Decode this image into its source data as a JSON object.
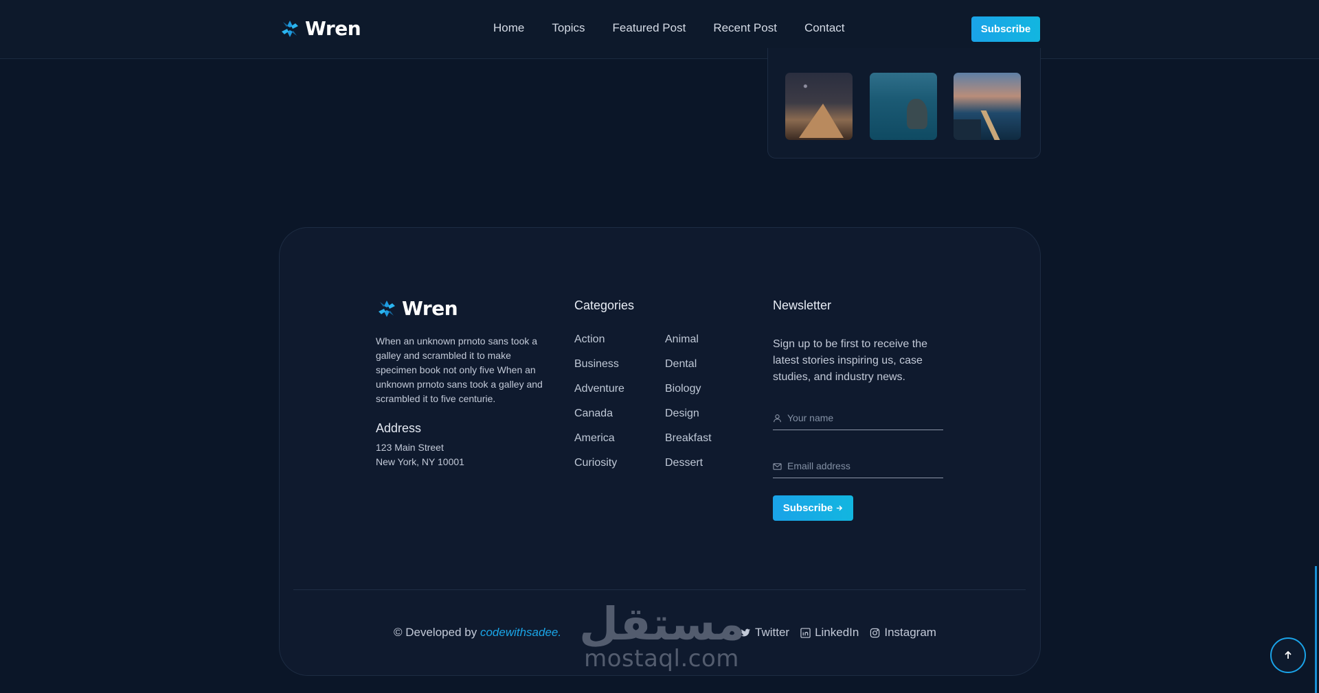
{
  "header": {
    "brand": "Wren",
    "nav": [
      "Home",
      "Topics",
      "Featured Post",
      "Recent Post",
      "Contact"
    ],
    "subscribe_label": "Subscribe"
  },
  "footer": {
    "brand": "Wren",
    "description": "When an unknown prnoto sans took a galley and scrambled it to make specimen book not only five When an unknown prnoto sans took a galley and scrambled it to five centurie.",
    "address_title": "Address",
    "address_line1": "123 Main Street",
    "address_line2": "New York, NY 10001",
    "categories_title": "Categories",
    "categories_left": [
      "Action",
      "Business",
      "Adventure",
      "Canada",
      "America",
      "Curiosity"
    ],
    "categories_right": [
      "Animal",
      "Dental",
      "Biology",
      "Design",
      "Breakfast",
      "Dessert"
    ],
    "newsletter_title": "Newsletter",
    "newsletter_text": "Sign up to be first to receive the latest stories inspiring us, case studies, and industry news.",
    "name_placeholder": "Your name",
    "email_placeholder": "Emaill address",
    "subscribe_label": "Subscribe",
    "copyright_prefix": "© Developed by",
    "copyright_link": "codewithsadee.",
    "socials": [
      "Twitter",
      "LinkedIn",
      "Instagram"
    ]
  },
  "watermark": {
    "arabic": "مستقل",
    "latin": "mostaql.com"
  },
  "colors": {
    "background": "#0b1628",
    "accent": "#1aa3e8",
    "card": "#0f1a2e"
  }
}
